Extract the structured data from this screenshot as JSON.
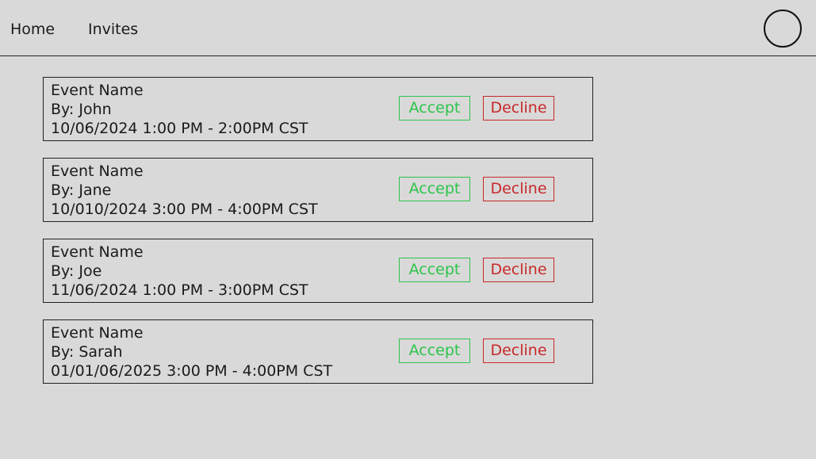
{
  "nav": {
    "home": "Home",
    "invites": "Invites"
  },
  "invites": [
    {
      "event_name": "Event Name",
      "by": "By: John",
      "datetime": "10/06/2024 1:00 PM - 2:00PM CST",
      "accept_label": "Accept",
      "decline_label": "Decline"
    },
    {
      "event_name": "Event Name",
      "by": "By: Jane",
      "datetime": "10/010/2024 3:00 PM - 4:00PM CST",
      "accept_label": "Accept",
      "decline_label": "Decline"
    },
    {
      "event_name": "Event Name",
      "by": "By: Joe",
      "datetime": "11/06/2024 1:00 PM - 3:00PM CST",
      "accept_label": "Accept",
      "decline_label": "Decline"
    },
    {
      "event_name": "Event Name",
      "by": "By: Sarah",
      "datetime": "01/01/06/2025 3:00 PM - 4:00PM CST",
      "accept_label": "Accept",
      "decline_label": "Decline"
    }
  ],
  "colors": {
    "background": "#d9d9d9",
    "accept": "#2dc44a",
    "decline": "#c82828"
  },
  "icons": {
    "avatar": "avatar-circle-icon"
  }
}
